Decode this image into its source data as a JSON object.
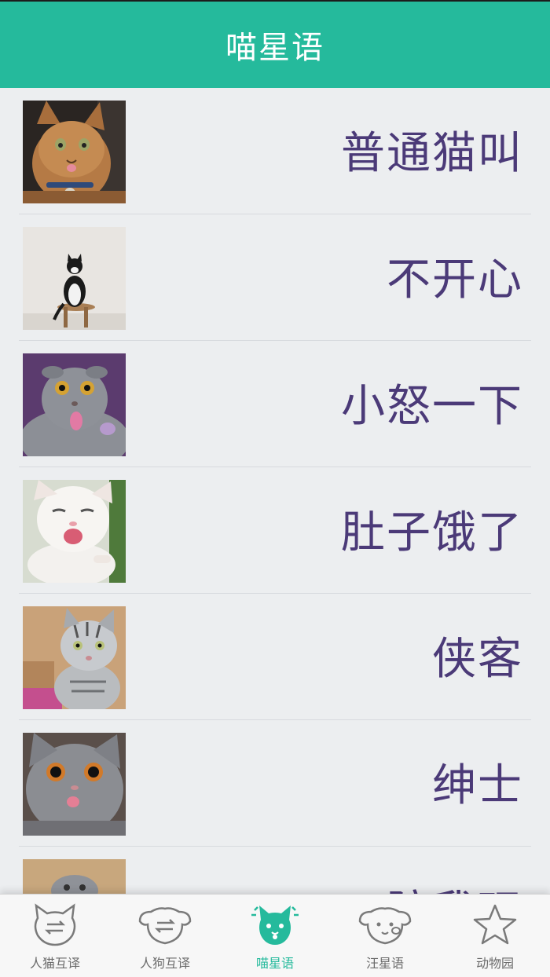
{
  "header": {
    "title": "喵星语"
  },
  "list": {
    "items": [
      {
        "label": "普通猫叫",
        "photo": "orange-tabby-cat-photo",
        "tone": "#9B6A3A"
      },
      {
        "label": "不开心",
        "photo": "tuxedo-cat-on-stool-photo",
        "tone": "#E5E2DD"
      },
      {
        "label": "小怒一下",
        "photo": "grey-scottish-fold-cat-photo",
        "tone": "#7C7F86"
      },
      {
        "label": "肚子饿了",
        "photo": "white-kitten-meowing-photo",
        "tone": "#F2EDEA"
      },
      {
        "label": "侠客",
        "photo": "silver-tabby-cat-photo",
        "tone": "#B99A7A"
      },
      {
        "label": "绅士",
        "photo": "grey-cat-big-eyes-photo",
        "tone": "#8A8A8E"
      },
      {
        "label": "陪我玩",
        "photo": "grey-kitten-photo",
        "tone": "#C8A77D"
      }
    ]
  },
  "tabbar": {
    "tabs": [
      {
        "label": "人猫互译",
        "icon": "cat-translate-icon",
        "active": false
      },
      {
        "label": "人狗互译",
        "icon": "dog-translate-icon",
        "active": false
      },
      {
        "label": "喵星语",
        "icon": "cat-face-icon",
        "active": true
      },
      {
        "label": "汪星语",
        "icon": "dog-face-icon",
        "active": false
      },
      {
        "label": "动物园",
        "icon": "star-icon",
        "active": false
      }
    ]
  },
  "colors": {
    "accent": "#25BA9C",
    "label_text": "#4B3A78",
    "background": "#ECEEF0",
    "tab_inactive": "#6b6b6b"
  }
}
